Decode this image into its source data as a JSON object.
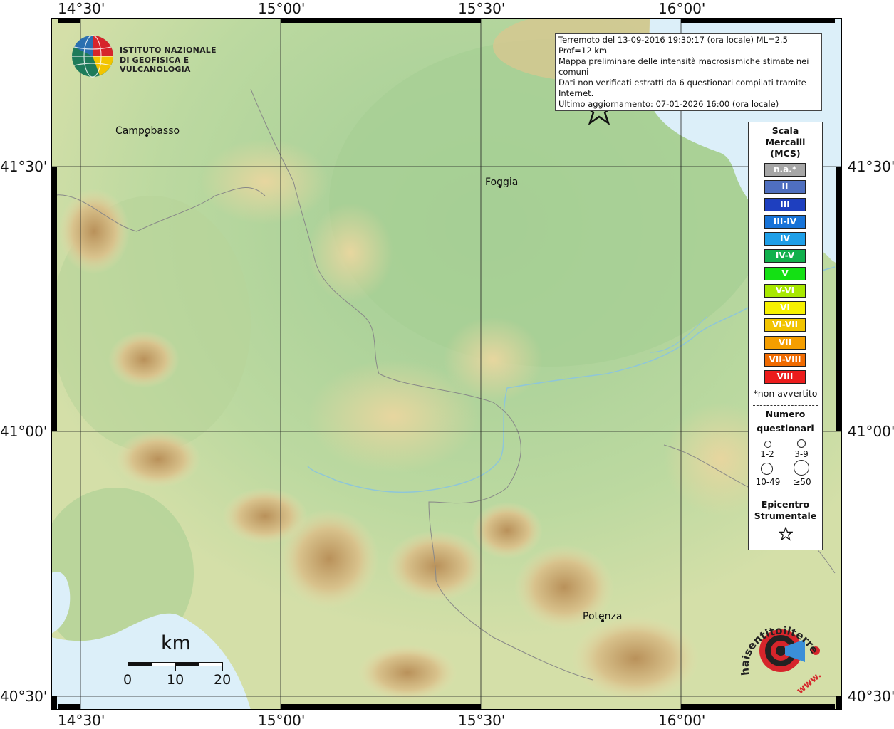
{
  "axes": {
    "top_ticks": [
      "14°30'",
      "15°00'",
      "15°30'",
      "16°00'"
    ],
    "bottom_ticks": [
      "14°30'",
      "15°00'",
      "15°30'",
      "16°00'"
    ],
    "left_ticks": [
      "41°30'",
      "41°00'",
      "40°30'"
    ],
    "right_ticks": [
      "41°30'",
      "41°00'",
      "40°30'"
    ]
  },
  "info": {
    "line1": "Terremoto del 13-09-2016 19:30:17 (ora locale) ML=2.5 Prof=12 km",
    "line2": "Mappa preliminare delle intensità macrosismiche stimate nei comuni",
    "line3": "Dati non verificati estratti da 6 questionari compilati tramite Internet.",
    "line4": "Ultimo aggiornamento: 07-01-2026 16:00 (ora locale)"
  },
  "ingv_logo": {
    "line1": "ISTITUTO NAZIONALE",
    "line2": "DI GEOFISICA E VULCANOLOGIA"
  },
  "cities": {
    "campobasso": "Campobasso",
    "foggia": "Foggia",
    "potenza": "Potenza"
  },
  "legend": {
    "title1": "Scala",
    "title2": "Mercalli",
    "title3": "(MCS)",
    "classes": [
      {
        "label": "n.a.*",
        "color": "#a6a6a6"
      },
      {
        "label": "II",
        "color": "#4f6fbf"
      },
      {
        "label": "III",
        "color": "#1e3fbf"
      },
      {
        "label": "III-IV",
        "color": "#1773d8"
      },
      {
        "label": "IV",
        "color": "#1e9fe8"
      },
      {
        "label": "IV-V",
        "color": "#11b04c"
      },
      {
        "label": "V",
        "color": "#14e014"
      },
      {
        "label": "V-VI",
        "color": "#a8e800"
      },
      {
        "label": "VI",
        "color": "#f6f000"
      },
      {
        "label": "VI-VII",
        "color": "#f2c400"
      },
      {
        "label": "VII",
        "color": "#f59e00"
      },
      {
        "label": "VII-VIII",
        "color": "#f06a00"
      },
      {
        "label": "VIII",
        "color": "#ec1c1c"
      }
    ],
    "not_felt_note": "*non avvertito",
    "count_title1": "Numero",
    "count_title2": "questionari",
    "count_classes": [
      "1-2",
      "3-9",
      "10-49",
      "≥50"
    ],
    "epicenter_title1": "Epicentro",
    "epicenter_title2": "Strumentale"
  },
  "scale_bar": {
    "unit": "km",
    "labels": [
      "0",
      "10",
      "20"
    ]
  },
  "hsit_logo": {
    "text": "haisentitoilterremoto.it",
    "url_text": "www."
  }
}
